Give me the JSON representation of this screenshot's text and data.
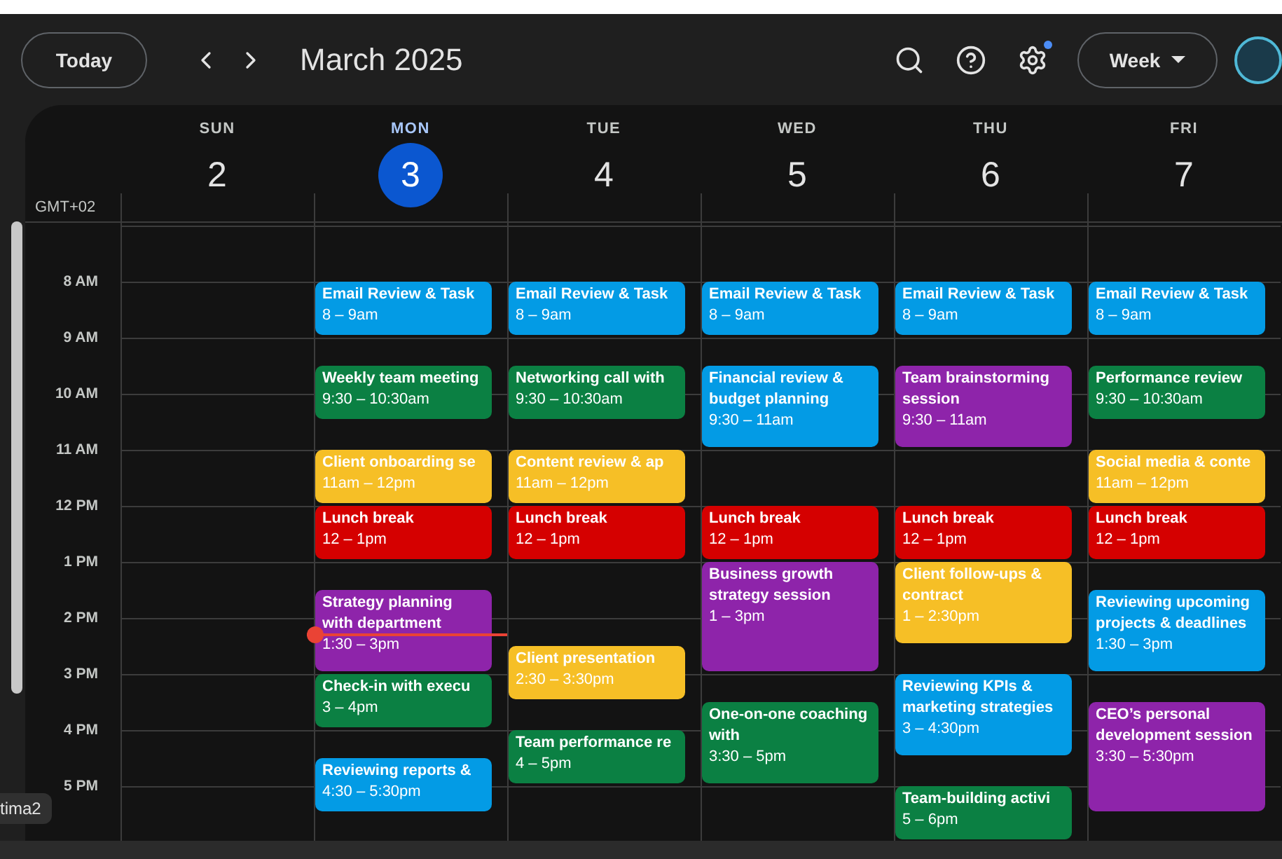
{
  "toolbar": {
    "today_button": "Today",
    "title": "March 2025",
    "settings_badge": true,
    "view_button": "Week"
  },
  "timezone": "GMT+02",
  "hours": [
    "8 AM",
    "9 AM",
    "10 AM",
    "11 AM",
    "12 PM",
    "1 PM",
    "2 PM",
    "3 PM",
    "4 PM",
    "5 PM"
  ],
  "days": [
    {
      "name": "SUN",
      "number": "2",
      "selected": false
    },
    {
      "name": "MON",
      "number": "3",
      "selected": true,
      "events": [
        {
          "title": "Email Review & Task",
          "time": "8 – 9am",
          "color": "#039be5"
        },
        {
          "title": "Weekly team meeting",
          "time": "9:30 – 10:30am",
          "color": "#0b8043"
        },
        {
          "title": "Client onboarding se",
          "time": "11am – 12pm",
          "color": "#f6bf26"
        },
        {
          "title": "Lunch break",
          "time": "12 – 1pm",
          "color": "#d50000"
        },
        {
          "title": "Strategy planning with department",
          "time": "1:30 – 3pm",
          "color": "#8e24aa"
        },
        {
          "title": "Check-in with execu",
          "time": "3 – 4pm",
          "color": "#0b8043"
        },
        {
          "title": "Reviewing reports &",
          "time": "4:30 – 5:30pm",
          "color": "#039be5"
        }
      ]
    },
    {
      "name": "TUE",
      "number": "4",
      "selected": false,
      "events": [
        {
          "title": "Email Review & Task",
          "time": "8 – 9am",
          "color": "#039be5"
        },
        {
          "title": "Networking call with",
          "time": "9:30 – 10:30am",
          "color": "#0b8043"
        },
        {
          "title": "Content review & ap",
          "time": "11am – 12pm",
          "color": "#f6bf26"
        },
        {
          "title": "Lunch break",
          "time": "12 – 1pm",
          "color": "#d50000"
        },
        {
          "title": "Client presentation",
          "time": "2:30 – 3:30pm",
          "color": "#f6bf26"
        },
        {
          "title": "Team performance re",
          "time": "4 – 5pm",
          "color": "#0b8043"
        }
      ]
    },
    {
      "name": "WED",
      "number": "5",
      "selected": false,
      "events": [
        {
          "title": "Email Review & Task",
          "time": "8 – 9am",
          "color": "#039be5"
        },
        {
          "title": "Financial review & budget planning",
          "time": "9:30 – 11am",
          "color": "#039be5"
        },
        {
          "title": "Lunch break",
          "time": "12 – 1pm",
          "color": "#d50000"
        },
        {
          "title": "Business growth strategy session",
          "time": "1 – 3pm",
          "color": "#8e24aa"
        },
        {
          "title": "One-on-one coaching with",
          "time": "3:30 – 5pm",
          "color": "#0b8043"
        }
      ]
    },
    {
      "name": "THU",
      "number": "6",
      "selected": false,
      "events": [
        {
          "title": "Email Review & Task",
          "time": "8 – 9am",
          "color": "#039be5"
        },
        {
          "title": "Team brainstorming session",
          "time": "9:30 – 11am",
          "color": "#8e24aa"
        },
        {
          "title": "Lunch break",
          "time": "12 – 1pm",
          "color": "#d50000"
        },
        {
          "title": "Client follow-ups & contract",
          "time": "1 – 2:30pm",
          "color": "#f6bf26"
        },
        {
          "title": "Reviewing KPIs & marketing strategies",
          "time": "3 – 4:30pm",
          "color": "#039be5"
        },
        {
          "title": "Team-building activi",
          "time": "5 – 6pm",
          "color": "#0b8043"
        }
      ]
    },
    {
      "name": "FRI",
      "number": "7",
      "selected": false,
      "events": [
        {
          "title": "Email Review & Task",
          "time": "8 – 9am",
          "color": "#039be5"
        },
        {
          "title": "Performance review",
          "time": "9:30 – 10:30am",
          "color": "#0b8043"
        },
        {
          "title": "Social media & conte",
          "time": "11am – 12pm",
          "color": "#f6bf26"
        },
        {
          "title": "Lunch break",
          "time": "12 – 1pm",
          "color": "#d50000"
        },
        {
          "title": "Reviewing upcoming projects & deadlines",
          "time": "1:30 – 3pm",
          "color": "#039be5"
        },
        {
          "title": "CEO’s personal development session",
          "time": "3:30 – 5:30pm",
          "color": "#8e24aa"
        }
      ]
    }
  ],
  "tooltip": "tima2"
}
